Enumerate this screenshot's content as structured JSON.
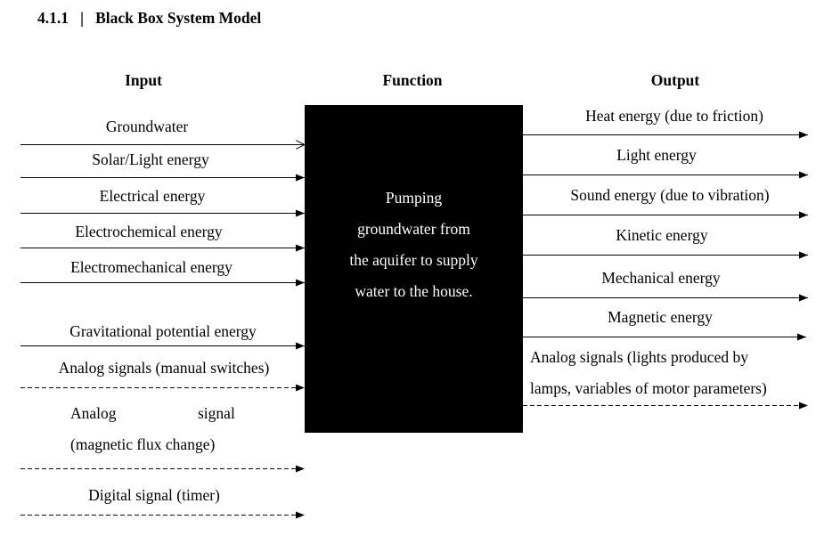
{
  "section_number": "4.1.1",
  "section_separator": "|",
  "title": "Black Box System Model",
  "columns": {
    "input": "Input",
    "function": "Function",
    "output": "Output"
  },
  "function_text": [
    "Pumping",
    "groundwater from",
    "the aquifer to supply",
    "water to the house."
  ],
  "inputs": [
    {
      "label": "Groundwater",
      "line": "solid",
      "arrowhead": "open"
    },
    {
      "label": "Solar/Light energy",
      "line": "solid",
      "arrowhead": "filled"
    },
    {
      "label": "Electrical energy",
      "line": "solid",
      "arrowhead": "filled"
    },
    {
      "label": "Electrochemical energy",
      "line": "solid",
      "arrowhead": "filled"
    },
    {
      "label": "Electromechanical energy",
      "line": "solid",
      "arrowhead": "filled"
    },
    {
      "label": "Gravitational potential energy",
      "line": "solid",
      "arrowhead": "filled"
    },
    {
      "label": "Analog signals (manual switches)",
      "line": "dashed",
      "arrowhead": "filled"
    },
    {
      "label_word1": "Analog",
      "label_word2": "signal",
      "label_line2": "(magnetic flux change)",
      "line": "dashed",
      "arrowhead": "filled"
    },
    {
      "label": "Digital signal (timer)",
      "line": "dashed",
      "arrowhead": "filled"
    }
  ],
  "outputs": [
    {
      "label": "Heat energy (due to friction)",
      "line": "solid",
      "arrowhead": "filled"
    },
    {
      "label": "Light energy",
      "line": "solid",
      "arrowhead": "filled"
    },
    {
      "label": "Sound energy (due to vibration)",
      "line": "solid",
      "arrowhead": "filled"
    },
    {
      "label": "Kinetic energy",
      "line": "solid",
      "arrowhead": "filled"
    },
    {
      "label": "Mechanical energy",
      "line": "solid",
      "arrowhead": "filled"
    },
    {
      "label": "Magnetic energy",
      "line": "solid",
      "arrowhead": "filled"
    },
    {
      "label_line1": "Analog signals (lights produced by",
      "label_line2": "lamps, variables of motor parameters)",
      "line": "dashed",
      "arrowhead": "filled"
    }
  ]
}
